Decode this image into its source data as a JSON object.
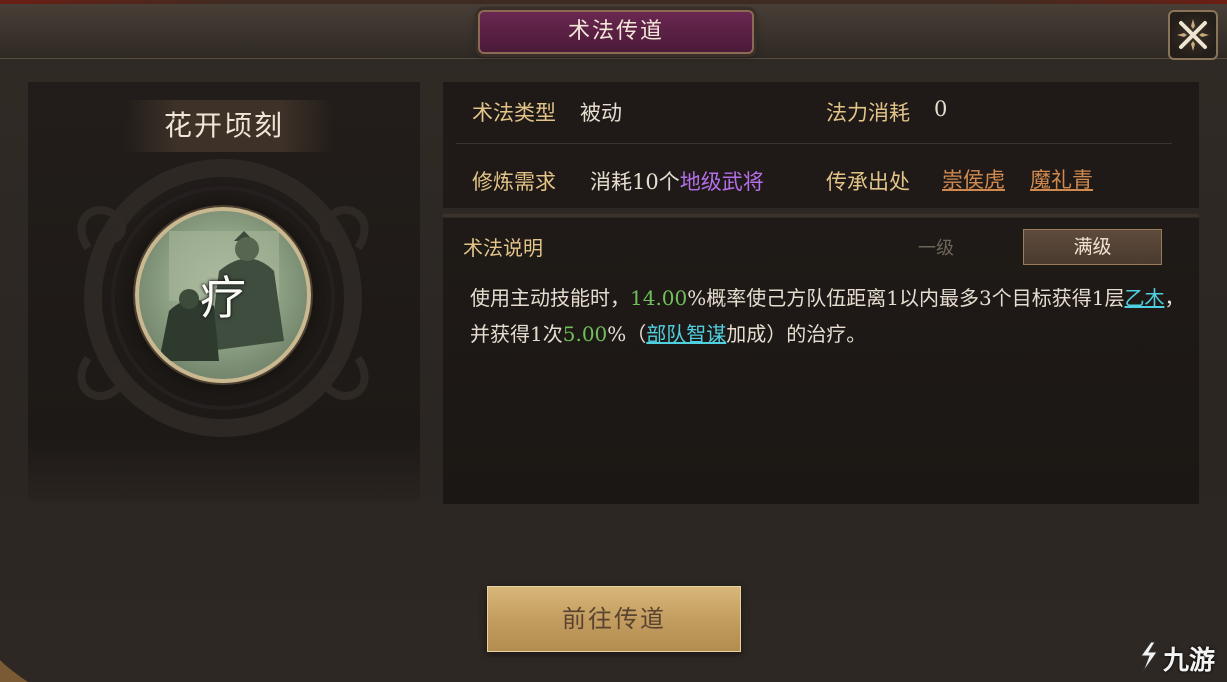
{
  "header": {
    "title": "术法传道"
  },
  "skill": {
    "name": "花开顷刻",
    "icon_glyph": "疗",
    "icon": "healing-skill-icon"
  },
  "info": {
    "type_label": "术法类型",
    "type_value": "被动",
    "cost_label": "法力消耗",
    "cost_value": "0",
    "req_label": "修炼需求",
    "req_value_prefix": "消耗10个",
    "req_value_highlight": "地级武将",
    "source_label": "传承出处",
    "sources": [
      "崇侯虎",
      "魔礼青"
    ]
  },
  "description": {
    "label": "术法说明",
    "level_one": "一级",
    "level_max": "满级",
    "parts": [
      "使用主动技能时，",
      "14.00",
      "%概率使己方队伍距离1以内最多3个目标获得1层",
      "乙木",
      "，并获得1次",
      "5.00",
      "%（",
      "部队智谋",
      "加成）的治疗。"
    ]
  },
  "actions": {
    "go_label": "前往传道"
  },
  "watermark": {
    "text": "九游"
  },
  "colors": {
    "accent_gold": "#e3c488",
    "highlight_green": "#6fbf5a",
    "highlight_cyan": "#4fd0e0",
    "highlight_purple": "#b46ee8",
    "link_orange": "#d08a50"
  }
}
